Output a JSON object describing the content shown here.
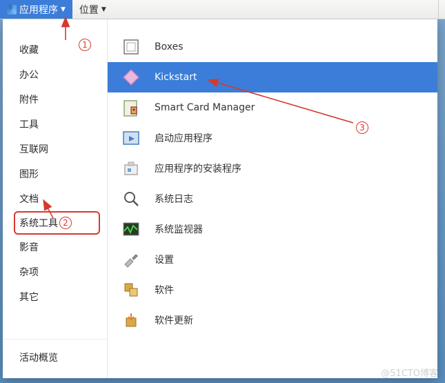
{
  "menubar": {
    "apps_label": "应用程序",
    "places_label": "位置"
  },
  "sidebar": {
    "items": [
      {
        "label": "收藏"
      },
      {
        "label": "办公"
      },
      {
        "label": "附件"
      },
      {
        "label": "工具"
      },
      {
        "label": "互联网"
      },
      {
        "label": "图形"
      },
      {
        "label": "文档"
      },
      {
        "label": "系统工具"
      },
      {
        "label": "影音"
      },
      {
        "label": "杂项"
      },
      {
        "label": "其它"
      }
    ],
    "activities_label": "活动概览"
  },
  "apps": [
    {
      "label": "Boxes",
      "icon": "boxes-icon"
    },
    {
      "label": "Kickstart",
      "icon": "kickstart-icon"
    },
    {
      "label": "Smart Card Manager",
      "icon": "smartcard-icon"
    },
    {
      "label": "启动应用程序",
      "icon": "startup-apps-icon"
    },
    {
      "label": "应用程序的安装程序",
      "icon": "app-installer-icon"
    },
    {
      "label": "系统日志",
      "icon": "system-log-icon"
    },
    {
      "label": "系统监视器",
      "icon": "system-monitor-icon"
    },
    {
      "label": "设置",
      "icon": "settings-icon"
    },
    {
      "label": "软件",
      "icon": "software-icon"
    },
    {
      "label": "软件更新",
      "icon": "software-update-icon"
    }
  ],
  "annotations": {
    "step1": "1",
    "step2": "2",
    "step3": "3"
  },
  "watermark": "@51CTO博客"
}
